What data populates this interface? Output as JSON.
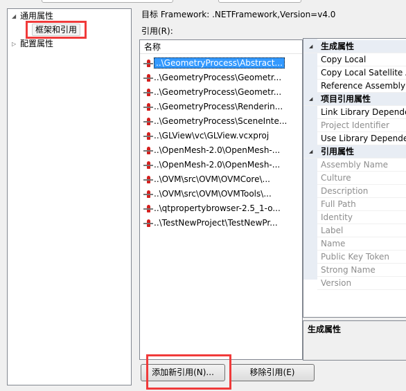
{
  "tree": {
    "items": [
      {
        "label": "通用属性",
        "expanded": true,
        "children": [
          {
            "label": "框架和引用",
            "selected": true
          }
        ]
      },
      {
        "label": "配置属性",
        "expanded": false
      }
    ]
  },
  "target_label": "目标 Framework:  .NETFramework,Version=v4.0",
  "references_label": "引用(R):",
  "list": {
    "column": "名称",
    "rows": [
      "..\\GeometryProcess\\Abstract...",
      "..\\GeometryProcess\\Geometr...",
      "..\\GeometryProcess\\Geometr...",
      "..\\GeometryProcess\\Renderin...",
      "..\\GeometryProcess\\SceneInte...",
      "..\\GLView\\vc\\GLView.vcxproj",
      "..\\OpenMesh-2.0\\OpenMesh-...",
      "..\\OpenMesh-2.0\\OpenMesh-...",
      "..\\OVM\\src\\OVM\\OVMCore\\...",
      "..\\OVM\\src\\OVM\\OVMTools\\...",
      "..\\qtpropertybrowser-2.5_1-o...",
      "..\\TestNewProject\\TestNewPr..."
    ]
  },
  "properties": [
    {
      "category": "生成属性",
      "items": [
        {
          "label": "Copy Local",
          "disabled": false
        },
        {
          "label": "Copy Local Satellite Assemblies",
          "disabled": false
        },
        {
          "label": "Reference Assembly Output",
          "disabled": false
        }
      ]
    },
    {
      "category": "项目引用属性",
      "items": [
        {
          "label": "Link Library Dependencies",
          "disabled": false
        },
        {
          "label": "Project Identifier",
          "disabled": true
        },
        {
          "label": "Use Library Dependency Inputs",
          "disabled": false
        }
      ]
    },
    {
      "category": "引用属性",
      "items": [
        {
          "label": "Assembly Name",
          "disabled": true
        },
        {
          "label": "Culture",
          "disabled": true
        },
        {
          "label": "Description",
          "disabled": true
        },
        {
          "label": "Full Path",
          "disabled": true
        },
        {
          "label": "Identity",
          "disabled": true
        },
        {
          "label": "Label",
          "disabled": true
        },
        {
          "label": "Name",
          "disabled": true
        },
        {
          "label": "Public Key Token",
          "disabled": true
        },
        {
          "label": "Strong Name",
          "disabled": true
        },
        {
          "label": "Version",
          "disabled": true
        }
      ]
    }
  ],
  "description_title": "生成属性",
  "buttons": {
    "add": "添加新引用(N)...",
    "remove": "移除引用(E)"
  },
  "colors": {
    "highlight": "#f03a3a",
    "selection": "#3399ff"
  }
}
